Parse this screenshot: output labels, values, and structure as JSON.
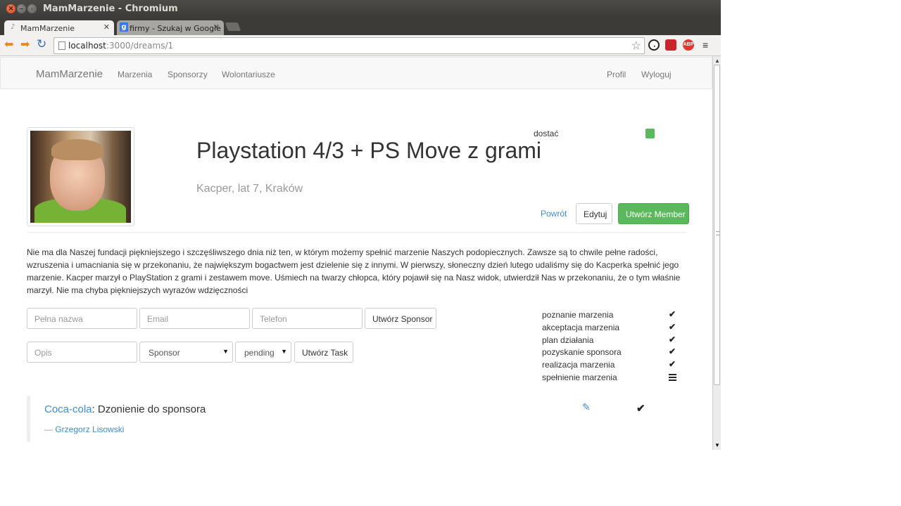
{
  "window": {
    "title": "MamMarzenie - Chromium",
    "close_glyph": "✕",
    "min_glyph": "–",
    "max_glyph": "▫"
  },
  "tabs": [
    {
      "label": "MamMarzenie",
      "favicon": "♪",
      "close": "✕"
    },
    {
      "label": "firmy - Szukaj w Google",
      "favicon": "g",
      "close": "✕"
    }
  ],
  "toolbar": {
    "back_glyph": "⬅",
    "forward_glyph": "➡",
    "reload_glyph": "↻",
    "url_host": "localhost",
    "url_path": ":3000/dreams/1",
    "star_glyph": "☆",
    "ext_adblock": "ABP",
    "menu_glyph": "≡"
  },
  "navbar": {
    "brand": "MamMarzenie",
    "links": [
      "Marzenia",
      "Sponsorzy",
      "Wolontariusze"
    ],
    "right_links": [
      "Profil",
      "Wyloguj"
    ]
  },
  "dream": {
    "title": "Playstation 4/3 + PS Move z grami",
    "subtitle": "Kacper, lat 7, Kraków",
    "status_label": "dostać",
    "status_color": "#5cb85c",
    "back_link": "Powrót",
    "edit_button": "Edytuj",
    "create_member_button": "Utwórz Member",
    "description": "Nie ma dla Naszej fundacji piękniejszego i szczęśliwszego dnia niż ten, w którym możemy spełnić marzenie Naszych podopiecznych. Zawsze są to chwile pełne radości, wzruszenia i umacniania się w przekonaniu, że największym bogactwem jest dzielenie się z innymi. W pierwszy, słoneczny dzień lutego udaliśmy się do Kacperka spełnić jego marzenie. Kacper marzył o PlayStation z grami i zestawem move. Uśmiech na twarzy chłopca, który pojawił się na Nasz widok, utwierdził Nas w przekonaniu, że o tym właśnie marzył. Nie ma chyba piękniejszych wyrazów wdzięczności"
  },
  "sponsor_form": {
    "name_placeholder": "Pełna nazwa",
    "email_placeholder": "Email",
    "phone_placeholder": "Telefon",
    "submit": "Utwórz Sponsor"
  },
  "task_form": {
    "description_placeholder": "Opis",
    "sponsor_select": "Sponsor",
    "status_select": "pending",
    "submit": "Utwórz Task"
  },
  "steps": [
    {
      "name": "poznanie marzenia",
      "icon": "check-icon"
    },
    {
      "name": "akceptacja marzenia",
      "icon": "check-icon"
    },
    {
      "name": "plan działania",
      "icon": "check-icon"
    },
    {
      "name": "pozyskanie sponsora",
      "icon": "check-icon"
    },
    {
      "name": "realizacja marzenia",
      "icon": "check-icon"
    },
    {
      "name": "spełnienie marzenia",
      "icon": "tasks-icon"
    }
  ],
  "task": {
    "sponsor": "Coca-cola",
    "text": ": Dzonienie do sponsora",
    "dash": "— ",
    "author": "Grzegorz Lisowski",
    "edit_glyph": "✎",
    "check_glyph": "✔"
  }
}
